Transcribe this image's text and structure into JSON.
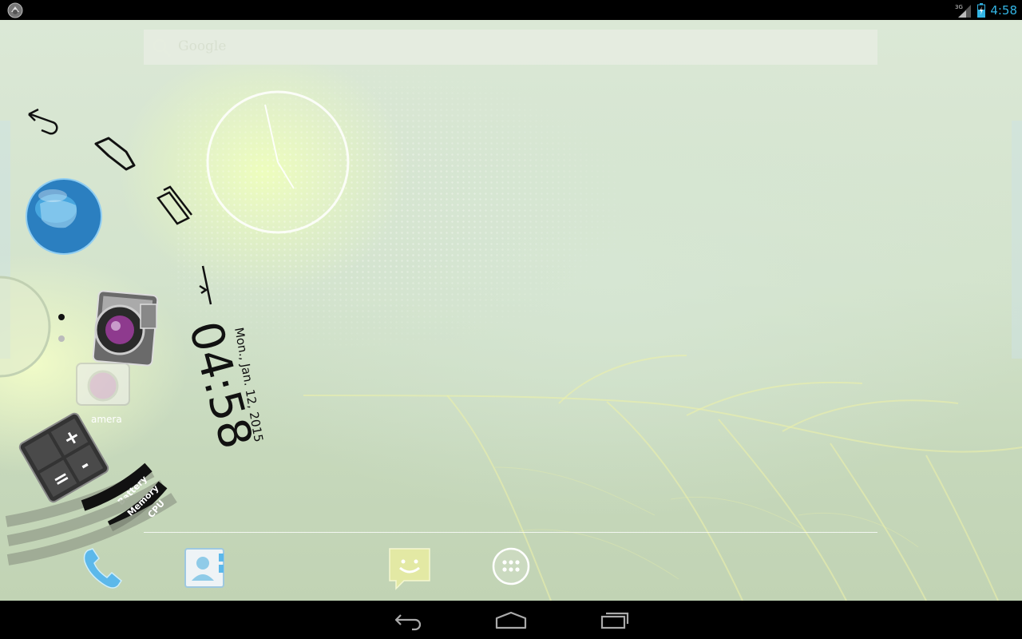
{
  "status_bar": {
    "network_type": "3G",
    "time": "4:58"
  },
  "search": {
    "placeholder": "Google"
  },
  "pie_widget": {
    "time": "04:58",
    "date": "Mon., Jan. 12, 2015",
    "bars": [
      {
        "label": "Battery"
      },
      {
        "label": "Memory"
      },
      {
        "label": "CPU"
      }
    ]
  },
  "shortcuts": {
    "camera_label": "amera"
  },
  "dock": {
    "items": [
      "phone-icon",
      "contacts-icon",
      "messaging-icon",
      "all-apps-icon"
    ]
  },
  "nav": {
    "buttons": [
      "back-icon",
      "home-icon",
      "recent-apps-icon"
    ]
  },
  "colors": {
    "status_accent": "#33b5e5",
    "wallpaper": "#d3e3cc"
  }
}
